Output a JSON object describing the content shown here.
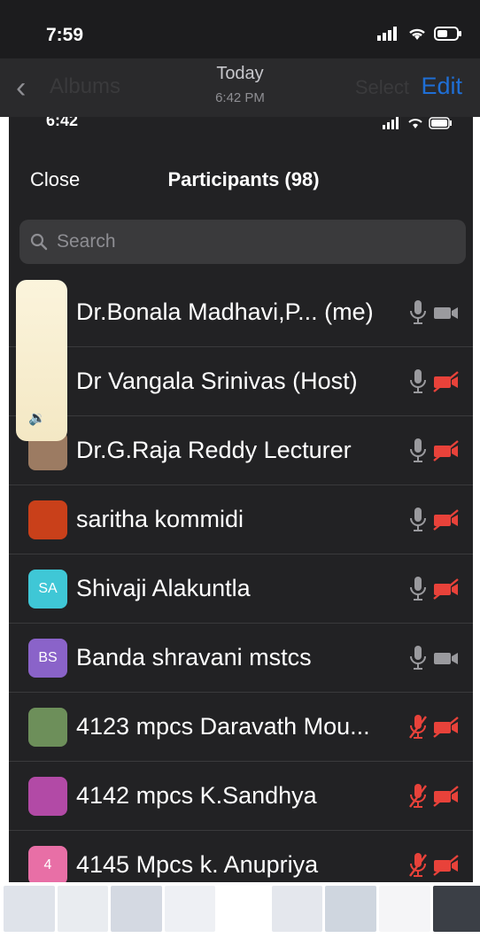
{
  "status": {
    "time": "7:59"
  },
  "photo_nav": {
    "back_label": "Albums",
    "title": "Today",
    "subtitle": "6:42 PM",
    "select_label": "Select",
    "edit_label": "Edit"
  },
  "inner": {
    "time": "6:42",
    "close_label": "Close",
    "title": "Participants",
    "count": "(98)",
    "search_placeholder": "Search",
    "participants": [
      {
        "name": "Dr.Bonala Madhavi,P...  (me)",
        "avatar": "",
        "avatar_color": "#d9c8a8",
        "mic": "on",
        "cam": "on"
      },
      {
        "name": "Dr Vangala Srinivas (Host)",
        "avatar": "",
        "avatar_color": "#d9c8a8",
        "mic": "on",
        "cam": "off"
      },
      {
        "name": "Dr.G.Raja Reddy Lecturer",
        "avatar": "",
        "avatar_color": "#9c7b62",
        "mic": "on",
        "cam": "off"
      },
      {
        "name": "saritha kommidi",
        "avatar": "",
        "avatar_color": "#c9401a",
        "mic": "on",
        "cam": "off"
      },
      {
        "name": "Shivaji Alakuntla",
        "avatar": "SA",
        "avatar_color": "#3fc7d6",
        "mic": "on",
        "cam": "off"
      },
      {
        "name": "Banda shravani mstcs",
        "avatar": "BS",
        "avatar_color": "#8a63c9",
        "mic": "on",
        "cam": "on"
      },
      {
        "name": "4123 mpcs Daravath Mou...",
        "avatar": "",
        "avatar_color": "#6d8f5a",
        "mic": "off",
        "cam": "off"
      },
      {
        "name": "4142 mpcs K.Sandhya",
        "avatar": "",
        "avatar_color": "#b24aa6",
        "mic": "off",
        "cam": "off"
      },
      {
        "name": "4145  Mpcs k. Anupriya",
        "avatar": "4",
        "avatar_color": "#e86fa6",
        "mic": "off",
        "cam": "off"
      }
    ]
  },
  "colors": {
    "muted_red": "#e8423a",
    "icon_grey": "#9a9a9e",
    "accent": "#1f6fd6"
  },
  "thumb_colors": [
    "#dfe3ea",
    "#e9ecf0",
    "#d4d9e2",
    "#eef0f4",
    "#ffffff",
    "#e4e7ed",
    "#cfd6df",
    "#f5f5f7",
    "#3b3f46",
    "#4a4f58",
    "#2f3338",
    "#5a5f66",
    "#3f444b",
    "#2a2d32",
    "#4b5056",
    "#383c42",
    "#50555c"
  ]
}
